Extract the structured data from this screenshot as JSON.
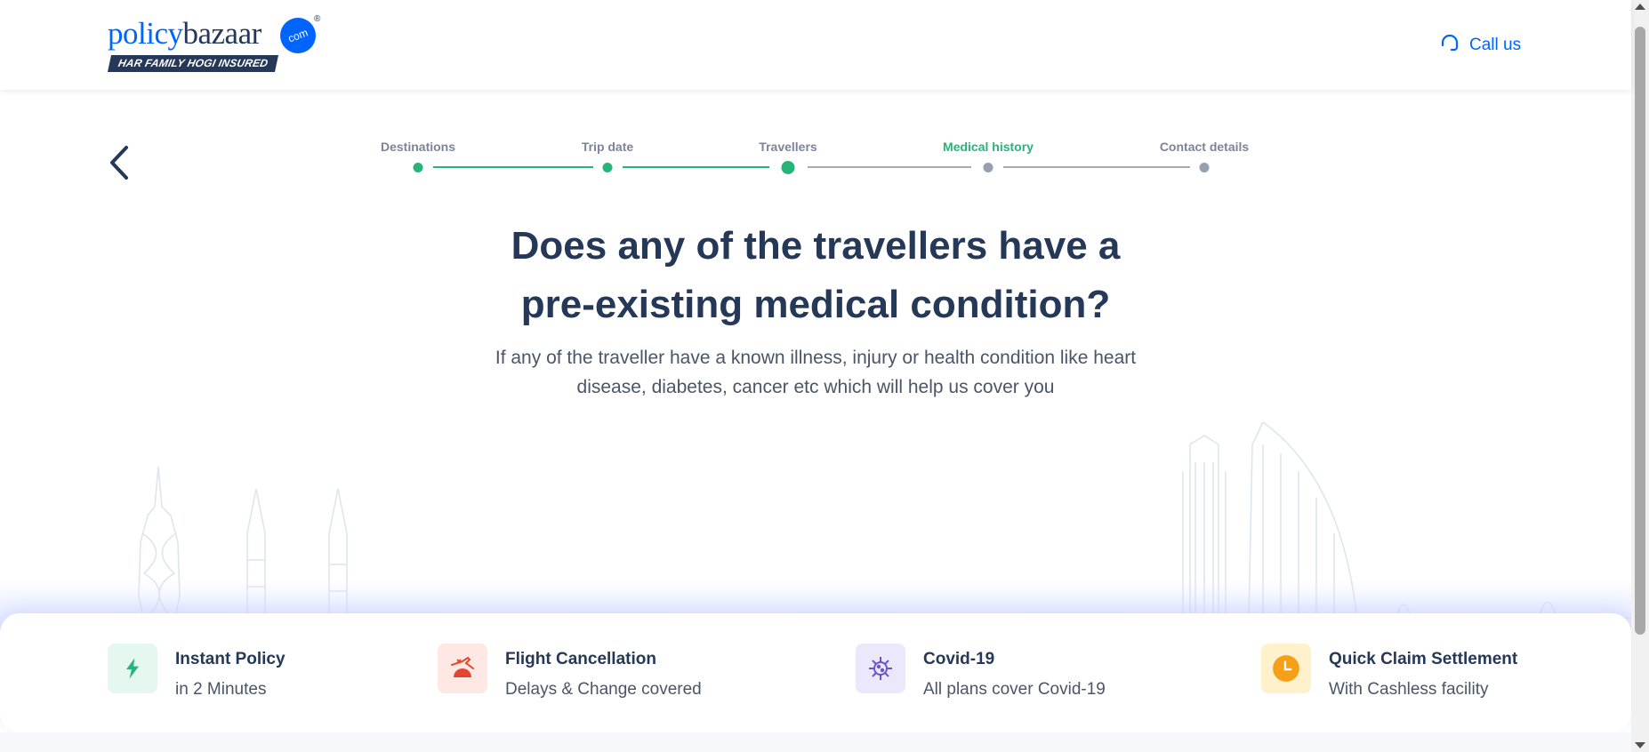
{
  "brand": {
    "logo_part1": "policy",
    "logo_part2": "bazaar",
    "logo_dot": "com",
    "logo_reg": "®",
    "tagline": "HAR FAMILY HOGI INSURED"
  },
  "header": {
    "call_label": "Call us",
    "call_icon": "headset-icon"
  },
  "stepper": {
    "steps": [
      {
        "label": "Destinations",
        "state": "done"
      },
      {
        "label": "Trip date",
        "state": "done"
      },
      {
        "label": "Travellers",
        "state": "done"
      },
      {
        "label": "Medical history",
        "state": "current"
      },
      {
        "label": "Contact details",
        "state": "pending"
      }
    ]
  },
  "question": {
    "title_line1": "Does any of the travellers have a",
    "title_line2": "pre-existing medical condition?",
    "subtitle_line1": "If any of the traveller have a known illness, injury or health condition like heart",
    "subtitle_line2": "disease, diabetes, cancer etc which will help us cover you"
  },
  "features": [
    {
      "title": "Instant Policy",
      "subtitle": "in 2 Minutes",
      "icon": "lightning-icon",
      "bg": "#e6f7ef",
      "color": "#27b47a"
    },
    {
      "title": "Flight Cancellation",
      "subtitle": "Delays & Change covered",
      "icon": "flight-cancel-icon",
      "bg": "#fde8e4",
      "color": "#e2462e"
    },
    {
      "title": "Covid-19",
      "subtitle": "All plans cover Covid-19",
      "icon": "virus-icon",
      "bg": "#ece8fb",
      "color": "#6b55c9"
    },
    {
      "title": "Quick Claim Settlement",
      "subtitle": "With Cashless facility",
      "icon": "clock-icon",
      "bg": "#fff1cc",
      "color": "#f6a01a"
    }
  ],
  "colors": {
    "primary": "#0065ff",
    "navy": "#253858",
    "green": "#27b47a",
    "muted": "#7a8599"
  }
}
